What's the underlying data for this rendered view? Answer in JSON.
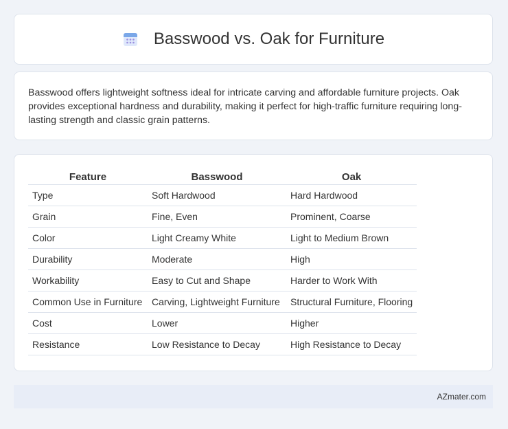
{
  "header": {
    "title": "Basswood vs. Oak for Furniture",
    "icon": "calendar-icon"
  },
  "summary": {
    "text": "Basswood offers lightweight softness ideal for intricate carving and affordable furniture projects. Oak provides exceptional hardness and durability, making it perfect for high-traffic furniture requiring long-lasting strength and classic grain patterns."
  },
  "table": {
    "columns": [
      "Feature",
      "Basswood",
      "Oak"
    ],
    "rows": [
      [
        "Type",
        "Soft Hardwood",
        "Hard Hardwood"
      ],
      [
        "Grain",
        "Fine, Even",
        "Prominent, Coarse"
      ],
      [
        "Color",
        "Light Creamy White",
        "Light to Medium Brown"
      ],
      [
        "Durability",
        "Moderate",
        "High"
      ],
      [
        "Workability",
        "Easy to Cut and Shape",
        "Harder to Work With"
      ],
      [
        "Common Use in Furniture",
        "Carving, Lightweight Furniture",
        "Structural Furniture, Flooring"
      ],
      [
        "Cost",
        "Lower",
        "Higher"
      ],
      [
        "Resistance",
        "Low Resistance to Decay",
        "High Resistance to Decay"
      ]
    ]
  },
  "footer": {
    "text": "AZmater.com"
  },
  "colors": {
    "background": "#f0f3f8",
    "card": "#ffffff",
    "border": "#dde3ec",
    "footer": "#e8edf7",
    "icon_top": "#e86a7a",
    "icon_body": "#7aa7e8"
  }
}
